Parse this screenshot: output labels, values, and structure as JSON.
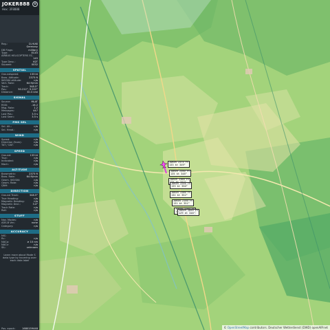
{
  "aircraft": {
    "callsign": "JOKER888",
    "hex_line": "Hex: 3F8888",
    "close_glyph": "⊗"
  },
  "details": [
    {
      "k": "Reg.:",
      "v": "D-HUKI"
    },
    {
      "k": "",
      "v": "Germany"
    },
    {
      "k": "DB Flags:",
      "v": "military"
    },
    {
      "k": "Type:",
      "v": "EC45"
    },
    {
      "k": "AIRBUS HELICOPTERS EC-",
      "v": ""
    },
    {
      "k": "",
      "v": "145"
    },
    {
      "k": "Type Desc.:",
      "v": "H2T"
    },
    {
      "k": "Squawk:",
      "v": "0032"
    }
  ],
  "sections": [
    {
      "title": "SPATIAL",
      "rows": [
        {
          "k": "Groundspeed:",
          "v": "133 kt"
        },
        {
          "k": "Baro. Altitude:",
          "v": "2375 ft"
        },
        {
          "k": "WGS84 altitude:",
          "v": "n/a"
        },
        {
          "k": "Vert. Rate:",
          "v": "64 ft/min"
        },
        {
          "k": "Track:",
          "v": "348.5°"
        },
        {
          "k": "Pos.:",
          "v": "50.212°, 9.222°"
        },
        {
          "k": "Distance:",
          "v": "30.3 nmi"
        }
      ]
    },
    {
      "title": "SIGNAL",
      "rows": [
        {
          "k": "Source:",
          "v": "MLAT"
        },
        {
          "k": "RSSI:",
          "v": "-16.2"
        },
        {
          "k": "Msg. Rate:",
          "v": "1.2"
        },
        {
          "k": "Messages:",
          "v": "447"
        },
        {
          "k": "Last Pos.:",
          "v": "3.5 s"
        },
        {
          "k": "Last Seen:",
          "v": "3.5 s"
        }
      ]
    },
    {
      "title": "FMS SEL",
      "rows": [
        {
          "k": "Sel. Alt.:",
          "v": "n/a"
        },
        {
          "k": "Sel. Head.:",
          "v": "n/a"
        }
      ]
    },
    {
      "title": "WIND",
      "rows": [
        {
          "k": "Speed:",
          "v": "n/a"
        },
        {
          "k": "Direction (from):",
          "v": "n/a"
        },
        {
          "k": "TAT / OAT:",
          "v": "n/a"
        }
      ]
    },
    {
      "title": "SPEED",
      "rows": [
        {
          "k": "Ground:",
          "v": "133 kt"
        },
        {
          "k": "True:",
          "v": "n/a"
        },
        {
          "k": "Indicated:",
          "v": "n/a"
        },
        {
          "k": "Mach:",
          "v": "n/a"
        }
      ]
    },
    {
      "title": "ALTITUDE",
      "rows": [
        {
          "k": "Barometric:",
          "v": "2375 ft"
        },
        {
          "k": "Baro. Rate:",
          "v": "64 ft/min"
        },
        {
          "k": "Geom. WGS84:",
          "v": "n/a"
        },
        {
          "k": "Geom. Rate:",
          "v": "n/a"
        },
        {
          "k": "QNH:",
          "v": "n/a"
        }
      ]
    },
    {
      "title": "DIRECTION",
      "rows": [
        {
          "k": "Ground Track:",
          "v": "348.5°"
        },
        {
          "k": "True Heading:",
          "v": "n/a"
        },
        {
          "k": "Magnetic Heading:",
          "v": "n/a"
        },
        {
          "k": "Magnetic Decl.:",
          "v": "3.4°"
        },
        {
          "k": "Track Rate:",
          "v": "n/a"
        },
        {
          "k": "Roll:",
          "v": "n/a"
        }
      ]
    },
    {
      "title": "STUFF",
      "rows": [
        {
          "k": "Nav. Modes:",
          "v": "n/a"
        },
        {
          "k": "ADS-B Ver.:",
          "v": "none"
        },
        {
          "k": "Category:",
          "v": "n/a"
        }
      ]
    },
    {
      "title": "ACCURACY",
      "rows": [
        {
          "k": "NIC:",
          "v": ""
        },
        {
          "k": "Rc:",
          "v": "n/a"
        },
        {
          "k": "NACp:",
          "v": "≥ 10 nm"
        },
        {
          "k": "NACv:",
          "v": "n/a"
        },
        {
          "k": "SIL:",
          "v": "unknown"
        }
      ]
    }
  ],
  "note": "Learn more about Mode S data type by hovering over each data label",
  "footer": {
    "k": "Pos. epoch:",
    "v": "1680159448"
  },
  "track_labels": [
    "JOKER 2375 ft\n133 kt 349°",
    "JOKER 2350 ft\n135 kt 348°",
    "JOKER 2300 ft\n134 kt 347°",
    "JOKER 2250 ft\n133 kt 350°",
    "JOKER 2200 ft\n132 kt 352°",
    "JOKER 2150 ft\n131 kt 351°",
    "JOKER 2100 ft\n130 kt 349°",
    "JOKER 2050 ft\n129 kt 348°"
  ],
  "attribution": {
    "prefix": "© ",
    "link": "OpenStreetMap",
    "suffix": " contributors. Deutscher Wetterdienst (DWD) openAIP.net"
  },
  "colors": {
    "track": "#e040e0",
    "sidebar": "#232a30",
    "section": "#1e6d86"
  }
}
